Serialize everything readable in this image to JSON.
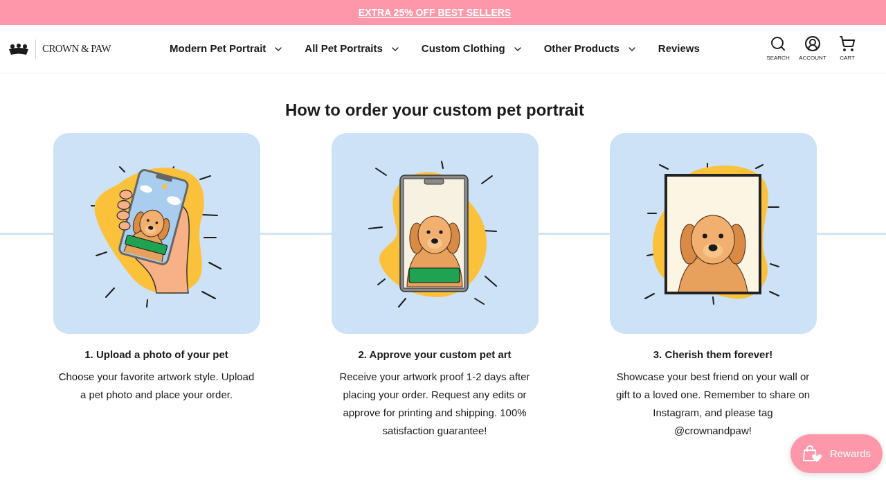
{
  "promo_banner": {
    "link": "EXTRA 25% OFF BEST SELLERS"
  },
  "header": {
    "logo": "CROWN & PAW",
    "nav": [
      {
        "label": "Modern Pet Portrait",
        "dropdown": true
      },
      {
        "label": "All Pet Portraits",
        "dropdown": true
      },
      {
        "label": "Custom Clothing",
        "dropdown": true
      },
      {
        "label": "Other Products",
        "dropdown": true
      },
      {
        "label": "Reviews",
        "dropdown": false
      }
    ],
    "actions": [
      {
        "kind": "search",
        "label": "SEARCH"
      },
      {
        "kind": "account",
        "label": "ACCOUNT"
      },
      {
        "kind": "cart",
        "label": "CART"
      }
    ]
  },
  "how_to_order": {
    "heading": "How to order your custom pet portrait",
    "steps": [
      {
        "kind": "upload",
        "title": "1. Upload a photo of your pet",
        "description": "Choose your favorite artwork style. Upload a pet photo and place your order."
      },
      {
        "kind": "approve",
        "title": "2. Approve your custom pet art",
        "description": "Receive your artwork proof 1-2 days after placing your order. Request any edits or approve for printing and shipping. 100% satisfaction guarantee!"
      },
      {
        "kind": "frame",
        "title": "3. Cherish them forever!",
        "description": "Showcase your best friend on your wall or gift to a loved one. Remember to share on Instagram, and please tag @crownandpaw!"
      }
    ]
  },
  "rewards_button": {
    "label": "Rewards"
  }
}
